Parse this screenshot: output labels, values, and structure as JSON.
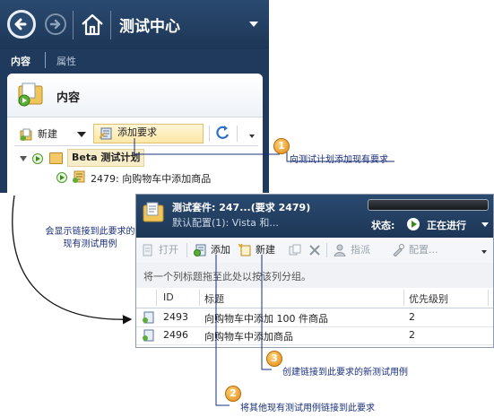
{
  "test_center": {
    "title": "测试中心",
    "tabs": [
      "内容",
      "属性"
    ],
    "panel_title": "内容",
    "toolbar": {
      "new_label": "新建",
      "add_requirement_label": "添加要求"
    },
    "tree": {
      "plan_label": "Beta 测试计划",
      "requirement_label": "2479: 向购物车中添加商品"
    }
  },
  "suite_window": {
    "title": "测试套件: 247...(要求 2479)",
    "config": "默认配置(1): Vista 和...",
    "status_label": "状态:",
    "status_value": "正在进行",
    "toolbar": {
      "open_label": "打开",
      "add_label": "添加",
      "new_label": "新建",
      "assign_label": "指派",
      "configure_label": "配置..."
    },
    "group_hint": "将一个列标题拖至此处以按该列分组。",
    "columns": [
      "ID",
      "标题",
      "优先级别"
    ],
    "rows": [
      {
        "id": "2493",
        "title": "向购物车中添加 100 件商品",
        "priority": "2"
      },
      {
        "id": "2496",
        "title": "向购物车中添加商品",
        "priority": "2"
      }
    ]
  },
  "callouts": {
    "c1": {
      "number": "1",
      "text": "向测试计划添加现有要求"
    },
    "c2": {
      "number": "2",
      "text": "将其他现有测试用例链接到此要求"
    },
    "c3": {
      "number": "3",
      "text": "创建链接到此要求的新测试用例"
    },
    "side_note": "会显示链接到此要求的现有测试用例"
  },
  "colors": {
    "header_navy": "#1d3656",
    "callout_text": "#1a2f7a",
    "badge_orange": "#e08a16",
    "highlight": "#fde7a6"
  }
}
